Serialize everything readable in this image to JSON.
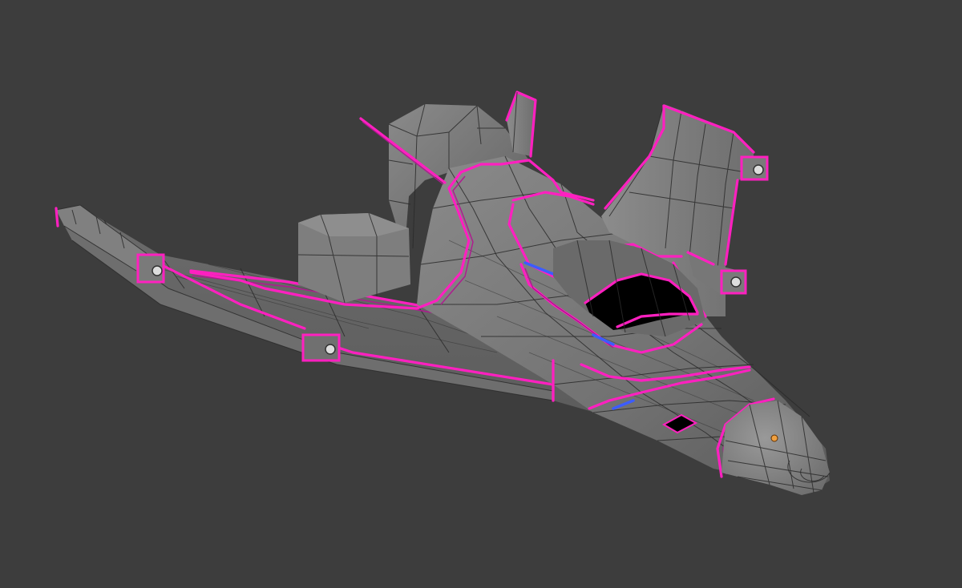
{
  "viewport": {
    "background": "#3d3d3d"
  },
  "model": {
    "surface_color": "#7a7a7a",
    "shade_color": "#5e5e5e",
    "highlight_color": "#8e8e8e",
    "wire_color": "#2a2a2a",
    "seam_color": "#ff20c0",
    "selected_seam_color": "#3c5cff",
    "cockpit_hole_color": "#000000",
    "origin_dot_color": "#f0a040"
  }
}
